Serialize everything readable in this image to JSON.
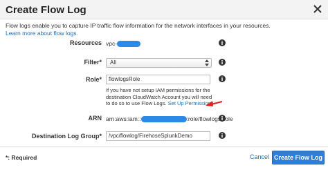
{
  "dialog": {
    "title": "Create Flow Log",
    "intro_text": "Flow logs enable you to capture IP traffic flow information for the network interfaces in your resources.",
    "learn_more": "Learn more about flow logs."
  },
  "form": {
    "resources_label": "Resources",
    "resources_prefix": "vpc-",
    "filter_label": "Filter*",
    "filter_value": "All",
    "role_label": "Role*",
    "role_value": "flowlogsRole",
    "help_text": "If you have not setup IAM permissions for the destination CloudWatch Account you will need to do so to use Flow Logs.",
    "setup_link": "Set Up Permissions",
    "arn_label": "ARN",
    "arn_prefix": "arn:aws:iam::",
    "arn_suffix": ":role/flowlogsRole",
    "dest_label": "Destination Log Group*",
    "dest_value": "/vpc/flowlog/FirehoseSplunkDemo"
  },
  "footer": {
    "required_note": "*: Required",
    "cancel_label": "Cancel",
    "create_label": "Create Flow Log"
  },
  "colors": {
    "link": "#1a6db5",
    "primary_button": "#2f7ed8",
    "redaction": "#2b8ae8",
    "annotation_arrow": "#e02020"
  },
  "icons": [
    "close-icon",
    "info-icon",
    "select-arrows-icon"
  ]
}
